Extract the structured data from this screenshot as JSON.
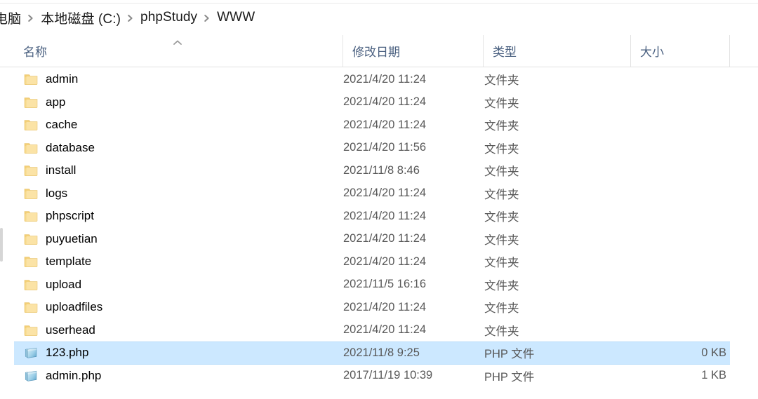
{
  "window": {
    "title": "WWW"
  },
  "address_bar": {
    "breadcrumb": [
      {
        "label": "电脑"
      },
      {
        "label": "本地磁盘 (C:)"
      },
      {
        "label": "phpStudy"
      },
      {
        "label": "WWW"
      }
    ],
    "separator_icon": "chevron-right-icon"
  },
  "columns": [
    {
      "key": "name",
      "label": "名称",
      "sorted": "ascending",
      "sort_icon": "chevron-up-icon"
    },
    {
      "key": "date",
      "label": "修改日期"
    },
    {
      "key": "type",
      "label": "类型"
    },
    {
      "key": "size",
      "label": "大小"
    }
  ],
  "files": [
    {
      "name": "admin",
      "date": "2021/4/20 11:24",
      "type": "文件夹",
      "size": "",
      "icon": "folder-icon",
      "selected": false
    },
    {
      "name": "app",
      "date": "2021/4/20 11:24",
      "type": "文件夹",
      "size": "",
      "icon": "folder-icon",
      "selected": false
    },
    {
      "name": "cache",
      "date": "2021/4/20 11:24",
      "type": "文件夹",
      "size": "",
      "icon": "folder-icon",
      "selected": false
    },
    {
      "name": "database",
      "date": "2021/4/20 11:56",
      "type": "文件夹",
      "size": "",
      "icon": "folder-icon",
      "selected": false
    },
    {
      "name": "install",
      "date": "2021/11/8 8:46",
      "type": "文件夹",
      "size": "",
      "icon": "folder-icon",
      "selected": false
    },
    {
      "name": "logs",
      "date": "2021/4/20 11:24",
      "type": "文件夹",
      "size": "",
      "icon": "folder-icon",
      "selected": false
    },
    {
      "name": "phpscript",
      "date": "2021/4/20 11:24",
      "type": "文件夹",
      "size": "",
      "icon": "folder-icon",
      "selected": false
    },
    {
      "name": "puyuetian",
      "date": "2021/4/20 11:24",
      "type": "文件夹",
      "size": "",
      "icon": "folder-icon",
      "selected": false
    },
    {
      "name": "template",
      "date": "2021/4/20 11:24",
      "type": "文件夹",
      "size": "",
      "icon": "folder-icon",
      "selected": false
    },
    {
      "name": "upload",
      "date": "2021/11/5 16:16",
      "type": "文件夹",
      "size": "",
      "icon": "folder-icon",
      "selected": false
    },
    {
      "name": "uploadfiles",
      "date": "2021/4/20 11:24",
      "type": "文件夹",
      "size": "",
      "icon": "folder-icon",
      "selected": false
    },
    {
      "name": "userhead",
      "date": "2021/4/20 11:24",
      "type": "文件夹",
      "size": "",
      "icon": "folder-icon",
      "selected": false
    },
    {
      "name": "123.php",
      "date": "2021/11/8 9:25",
      "type": "PHP 文件",
      "size": "0 KB",
      "icon": "php-file-icon",
      "selected": true
    },
    {
      "name": "admin.php",
      "date": "2017/11/19 10:39",
      "type": "PHP 文件",
      "size": "1 KB",
      "icon": "php-file-icon",
      "selected": false
    }
  ],
  "colors": {
    "selection": "#cce8ff",
    "selection_border": "#b7dcfa",
    "header_text": "#4a6080",
    "row_text": "#1b1b1b",
    "secondary_text": "#585858",
    "folder_fill": "#fbd98a",
    "folder_fill_light": "#fdecc4",
    "php_icon_blue": "#6fb4d8",
    "divider": "#e4e4e4"
  }
}
